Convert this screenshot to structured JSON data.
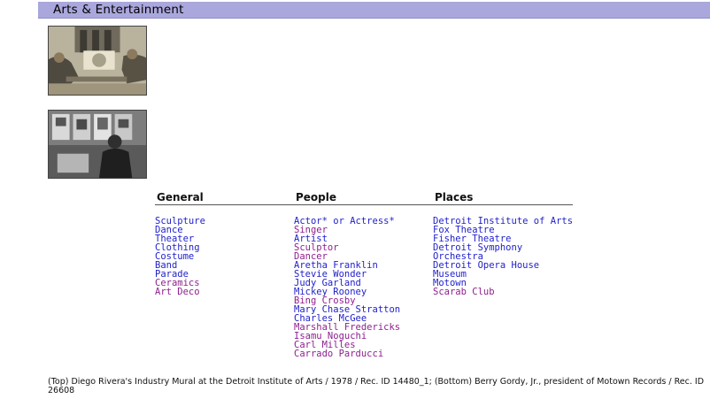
{
  "header": {
    "title": "Arts & Entertainment"
  },
  "columns": [
    {
      "heading": "General",
      "items": [
        {
          "label": "Sculpture",
          "visited": false
        },
        {
          "label": "Dance",
          "visited": false
        },
        {
          "label": "Theater",
          "visited": false
        },
        {
          "label": "Clothing",
          "visited": false
        },
        {
          "label": "Costume",
          "visited": false
        },
        {
          "label": "Band",
          "visited": false
        },
        {
          "label": "Parade",
          "visited": false
        },
        {
          "label": "Ceramics",
          "visited": true
        },
        {
          "label": "Art Deco",
          "visited": true
        }
      ]
    },
    {
      "heading": "People",
      "items": [
        {
          "label": "Actor* or Actress*",
          "visited": false
        },
        {
          "label": "Singer",
          "visited": true
        },
        {
          "label": "Artist",
          "visited": false
        },
        {
          "label": "Sculptor",
          "visited": true
        },
        {
          "label": "Dancer",
          "visited": true
        },
        {
          "label": "Aretha Franklin",
          "visited": false
        },
        {
          "label": "Stevie Wonder",
          "visited": false
        },
        {
          "label": "Judy Garland",
          "visited": false
        },
        {
          "label": "Mickey Rooney",
          "visited": false
        },
        {
          "label": "Bing Crosby",
          "visited": true
        },
        {
          "label": "Mary Chase Stratton",
          "visited": false
        },
        {
          "label": "Charles McGee",
          "visited": false
        },
        {
          "label": "Marshall Fredericks",
          "visited": true
        },
        {
          "label": "Isamu Noguchi",
          "visited": true
        },
        {
          "label": "Carl Milles",
          "visited": true
        },
        {
          "label": "Carrado Parducci",
          "visited": true
        }
      ]
    },
    {
      "heading": "Places",
      "items": [
        {
          "label": "Detroit Institute of Arts",
          "visited": false
        },
        {
          "label": "Fox Theatre",
          "visited": false
        },
        {
          "label": "Fisher Theatre",
          "visited": false
        },
        {
          "label": "Detroit Symphony",
          "visited": false
        },
        {
          "label": "Orchestra",
          "visited": false
        },
        {
          "label": "Detroit Opera House",
          "visited": false
        },
        {
          "label": "Museum",
          "visited": false
        },
        {
          "label": "Motown",
          "visited": false
        },
        {
          "label": "Scarab Club",
          "visited": true
        }
      ]
    }
  ],
  "caption": "(Top) Diego Rivera's Industry Mural at the Detroit Institute of Arts / 1978 / Rec. ID 14480_1; (Bottom) Berry Gordy, Jr., president of Motown Records / Rec. ID 26608",
  "colors": {
    "header_bg": "#aaa7dc",
    "link": "#1e1ecc",
    "visited_link": "#8e1f8e"
  }
}
